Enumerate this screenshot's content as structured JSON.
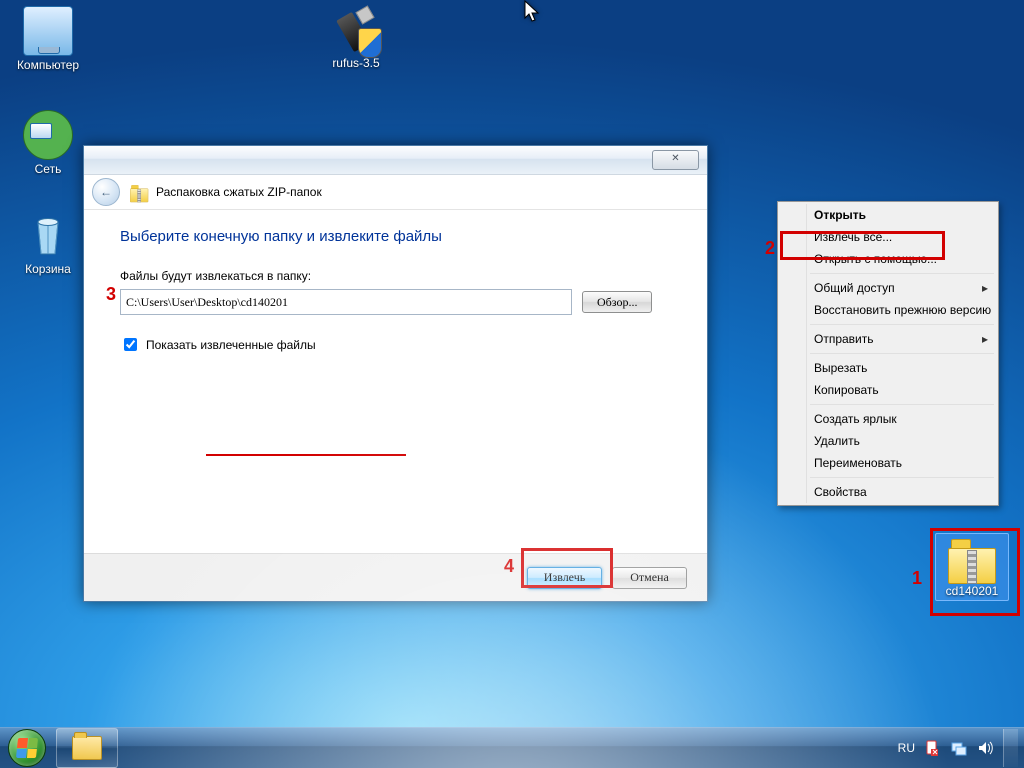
{
  "desktop_icons": {
    "computer": "Компьютер",
    "network": "Сеть",
    "bin": "Корзина",
    "rufus": "rufus-3.5",
    "zip": "cd140201"
  },
  "wizard": {
    "back_symbol": "←",
    "close_symbol": "✕",
    "title": "Распаковка сжатых ZIP-папок",
    "heading": "Выберите конечную папку и извлеките файлы",
    "dest_label": "Файлы будут извлекаться в папку:",
    "path": "C:\\Users\\User\\Desktop\\cd140201",
    "browse": "Обзор...",
    "show_files": "Показать извлеченные файлы",
    "extract": "Извлечь",
    "cancel": "Отмена"
  },
  "context_menu": {
    "open": "Открыть",
    "extract_all": "Извлечь все...",
    "open_with": "Открыть с помощью...",
    "share": "Общий доступ",
    "restore": "Восстановить прежнюю версию",
    "send_to": "Отправить",
    "cut": "Вырезать",
    "copy": "Копировать",
    "shortcut": "Создать ярлык",
    "delete": "Удалить",
    "rename": "Переименовать",
    "properties": "Свойства"
  },
  "annotations": {
    "n1": "1",
    "n2": "2",
    "n3": "3",
    "n4": "4"
  },
  "taskbar": {
    "lang": "RU"
  }
}
